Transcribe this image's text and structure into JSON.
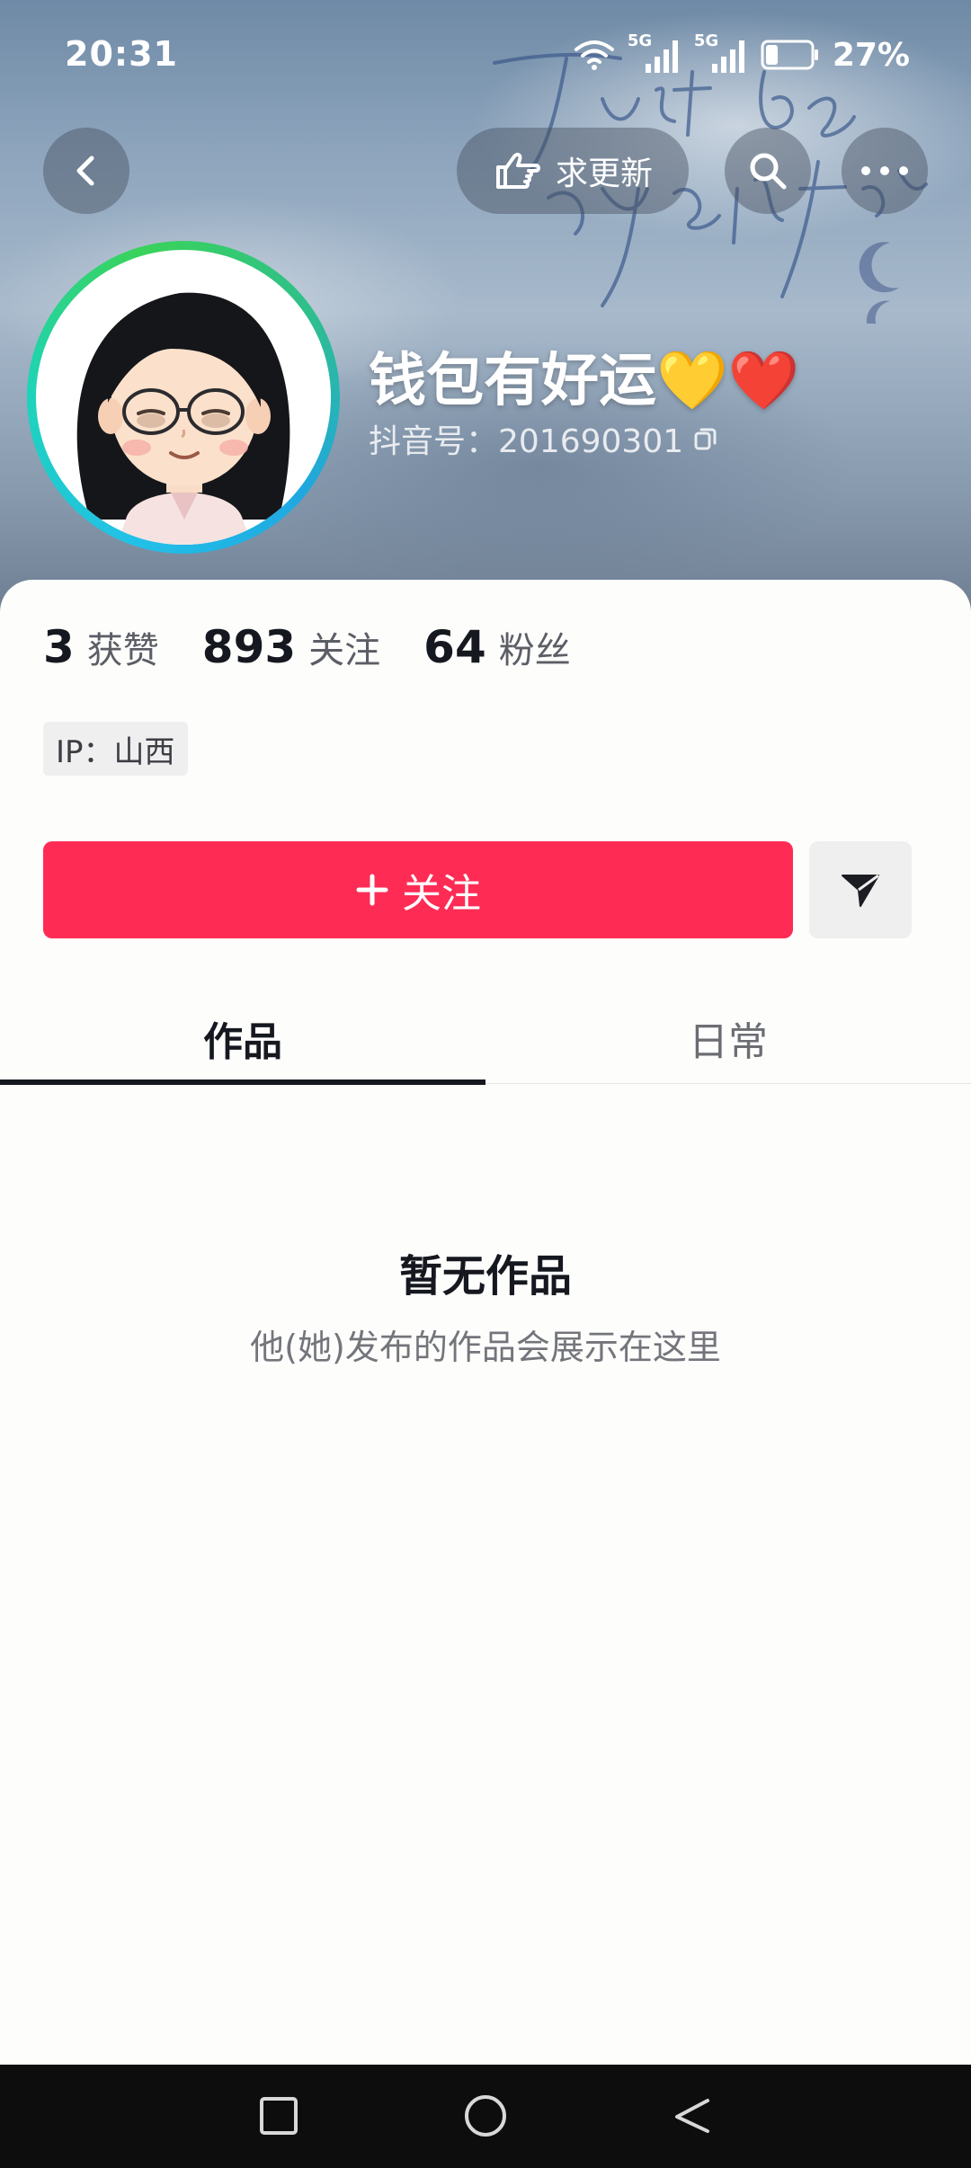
{
  "status_bar": {
    "time": "20:31",
    "network_1": "5G",
    "network_2": "5G",
    "battery": "27%",
    "battery_level": 0.27
  },
  "header": {
    "update_button_label": "求更新",
    "cover_text": "Just be yourself"
  },
  "profile": {
    "name": "钱包有好运💛❤️",
    "id_label": "抖音号：201690301"
  },
  "stats": [
    {
      "value": "3",
      "label": "获赞"
    },
    {
      "value": "893",
      "label": "关注"
    },
    {
      "value": "64",
      "label": "粉丝"
    }
  ],
  "ip_label": "IP：山西",
  "follow_button_label": "关注",
  "tabs": [
    {
      "label": "作品",
      "active": true
    },
    {
      "label": "日常",
      "active": false
    }
  ],
  "empty_state": {
    "title": "暂无作品",
    "description": "他(她)发布的作品会展示在这里"
  },
  "icons": [
    "back-icon",
    "hand-point-icon",
    "search-icon",
    "more-icon",
    "copy-icon",
    "plus-icon",
    "send-icon",
    "wifi-icon",
    "signal-icon",
    "battery-icon",
    "recent-apps-icon",
    "home-icon",
    "nav-back-icon"
  ],
  "colors": {
    "accent": "#fe2c55",
    "text_primary": "#16181f",
    "avatar_ring": "#22c1e8"
  }
}
